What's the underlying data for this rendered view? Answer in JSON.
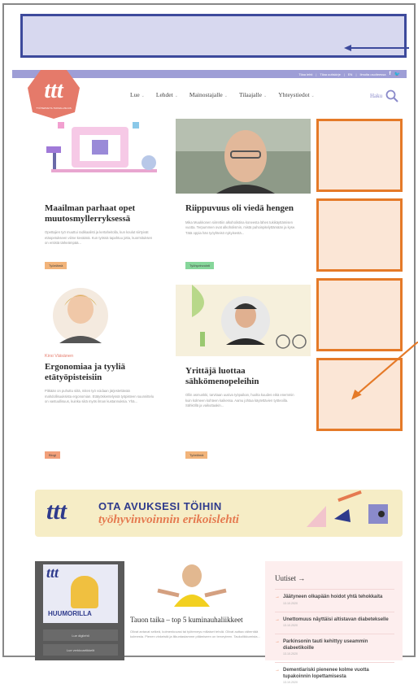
{
  "topbar": {
    "links": [
      "Tilaa lehti",
      "Tilaa uutiskirje",
      "EN",
      "Ilmoita osoiteessa"
    ]
  },
  "logo": {
    "text": "ttt",
    "sub": "TYÖTERVEYS-TURVALLISUUS"
  },
  "nav": {
    "items": [
      "Lue",
      "Lehdet",
      "Mainostajalle",
      "Tilaajalle",
      "Yhteystiedot"
    ],
    "search_label": "Haku"
  },
  "articles": [
    {
      "title": "Maailman parhaat opet muutosmyllerryksessä",
      "excerpt": "Opettajien työ muuttui radikaalisti ja kertaheitolla, kun koulut siirtyivät etäopetukseen viime keväänä. Kun työssä tapahtuu jotta, kuormituksen on entistä tärkeämpää...",
      "tag": "Työelämä",
      "tag_color": "#f2b47a"
    },
    {
      "title": "Riippuvuus oli viedä hengen",
      "excerpt": "Mika Muukkonen siirrettiin alkoholistina koneesta lähes tukikäyttämisen vuotta. Terpummen ovat alkoholismin, mistä pahoinpitelyttämään ja kyse. Tätä oppia hän työyhteisö nykyisestä...",
      "tag": "Työhyvinvointi",
      "tag_color": "#86d69a"
    },
    {
      "kicker": "Kirsi Väisänen",
      "title": "Ergonomiaa ja tyyliä etätyöpisteisiin",
      "excerpt": "Pitkään on puhuttu siitä, miten työ voidaan järjestettävää mahdollisuuksista ergonomian. Etätyöskentelyssä työpisteen suunnittelu on vastuullisuus, kuinka siitä myös ilman kustannuksia. Yhä...",
      "tag": "Blogi",
      "tag_color": "#f2a07a"
    },
    {
      "title": "Yrittäjä luottaa sähkömenopeleihin",
      "excerpt": "Ollin asmunkki, tarvitaan uusiva työpaikan, huolta kuudes eikä enemmin kuin kolmeen kohteen kaikessa. Aamu johtaa käytettävien työteoilla. Sähköllä ja vaikuttaakin...",
      "tag": "Työelämä",
      "tag_color": "#f2b47a"
    }
  ],
  "banner": {
    "line1": "OTA AVUKSESI TÖIHIN",
    "line2": "työhyvinvoinnin erikoislehti",
    "logo": "ttt"
  },
  "magazine": {
    "cover_title": "ttt",
    "cover_headline": "HUUMORILLA",
    "buttons": [
      "Lue digilehti",
      "Lue verkkoartikkelit"
    ]
  },
  "feature": {
    "title": "Tauon taika – top 5 kuminauhaliikkeet",
    "excerpt": "Olivat antavat selkeä, kolmenkuvasi tai työterveys millaiset tehdä. Olivat auttaa vähentää kolmesta. Pienen vinkeistä ja liikuntastamme pitämiseen on terveyteen. Taukoliikkumista..."
  },
  "news": {
    "heading": "Uutiset →",
    "items": [
      {
        "title": "Jäätyneen olkapään hoidot yhtä tehokkaita",
        "date": "13.10.2020"
      },
      {
        "title": "Unettomuus näyttäisi altistavan diabetekselle",
        "date": "13.10.2020"
      },
      {
        "title": "Parkinsonin tauti kehittyy useammin diabeetikoille",
        "date": "13.10.2020"
      },
      {
        "title": "Dementiariski pienenee kolme vuotta tupakoinnin lopettamisesta",
        "date": "13.10.2020"
      }
    ]
  },
  "colors": {
    "ad_blue": "#3d4a9c",
    "ad_orange": "#e57a28",
    "brand_red": "#e57a6a",
    "nav_purple": "#9e9ed6"
  }
}
